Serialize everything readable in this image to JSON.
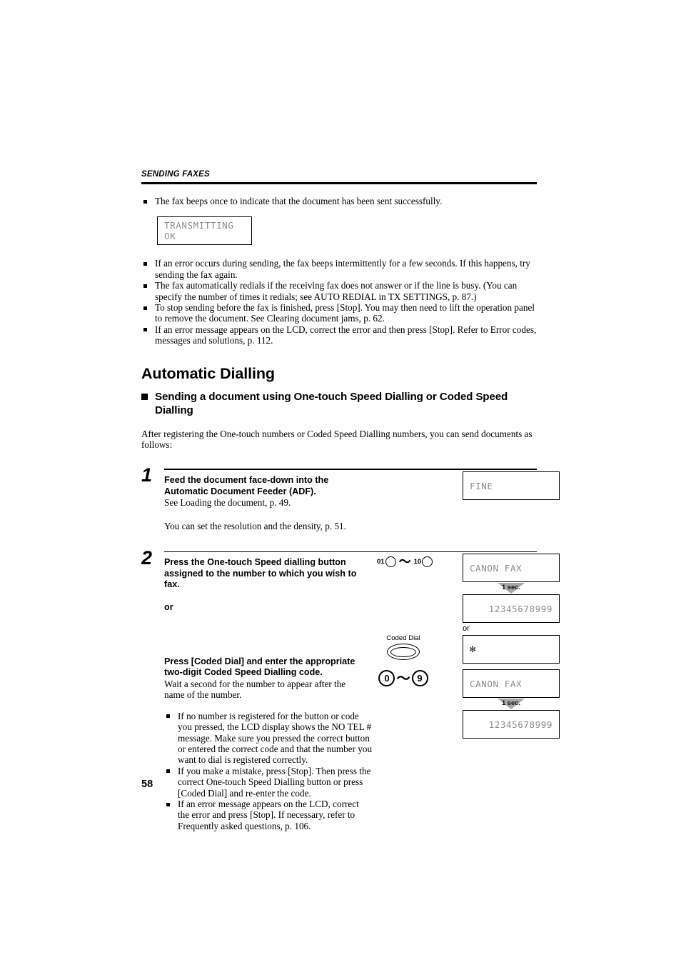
{
  "running_head": "SENDING FAXES",
  "page_number": "58",
  "intro_bullets": [
    "The fax beeps once to indicate that the document has been sent successfully."
  ],
  "lcd_transmitting": "TRANSMITTING OK",
  "notes_bullets": [
    "If an error occurs during sending, the fax beeps intermittently for a few seconds. If this happens, try sending the fax again.",
    "The fax automatically redials if the receiving fax does not answer or if the line is busy. (You can specify the number of times it redials; see AUTO REDIAL in TX SETTINGS, p. 87.)",
    "To stop sending before the fax is finished, press [Stop]. You may then need to lift the operation panel to remove the document. See Clearing document jams, p. 62.",
    "If an error message appears on the LCD, correct the error and then press [Stop]. Refer to Error codes, messages and solutions, p. 112."
  ],
  "section": {
    "title": "Automatic Dialling",
    "subtitle": "Sending a document using One-touch Speed Dialling or Coded Speed Dialling",
    "intro": "After registering the One-touch numbers or Coded Speed Dialling numbers, you can send documents as follows:"
  },
  "steps": [
    {
      "number": "1",
      "bold_lines": [
        "Feed the document face-down into the",
        "Automatic Document Feeder (ADF)."
      ],
      "plain_lines": [
        "See Loading the document, p. 49."
      ],
      "extra_line": "You can set the resolution and the density, p. 51.",
      "lcd": "FINE"
    },
    {
      "number": "2",
      "bold_lines": [
        "Press the One-touch Speed dialling button",
        "assigned to the number to which you wish to fax."
      ],
      "or_label": "or",
      "onetouch": {
        "from_label": "01",
        "to_label": "10",
        "range_glyph": "tilde-glyph"
      },
      "coded": {
        "bold_lines": [
          "Press [Coded Dial] and enter the appropriate",
          "two-digit Coded Speed Dialling code."
        ],
        "plain_lines": [
          "Wait a second for the number to appear after the",
          "name of the number."
        ],
        "button_label": "Coded Dial",
        "digit_from": "0",
        "digit_to": "9"
      },
      "sub_bullets": [
        "If no number is registered for the button or code you pressed, the LCD display shows the NO TEL # message. Make sure you pressed the correct button or entered the correct code and that the number you want to dial is registered correctly.",
        "If you make a mistake, press [Stop]. Then press the correct One-touch Speed Dialling button or press [Coded Dial] and re-enter the code.",
        "If an error message appears on the LCD, correct the error and press [Stop]. If necessary, refer to Frequently asked questions, p. 106."
      ],
      "lcd_sequence": {
        "lcd1": "CANON FAX",
        "delay1": "1 sec.",
        "lcd2": "12345678999",
        "or_label": "or",
        "lcd3": "✻",
        "lcd4": "CANON FAX",
        "delay2": "1 sec.",
        "lcd5": "12345678999"
      }
    }
  ],
  "colors": {
    "lcd_text": "#8d8d8d",
    "rule": "#000000",
    "delay_marker": "#a8a8a8"
  }
}
